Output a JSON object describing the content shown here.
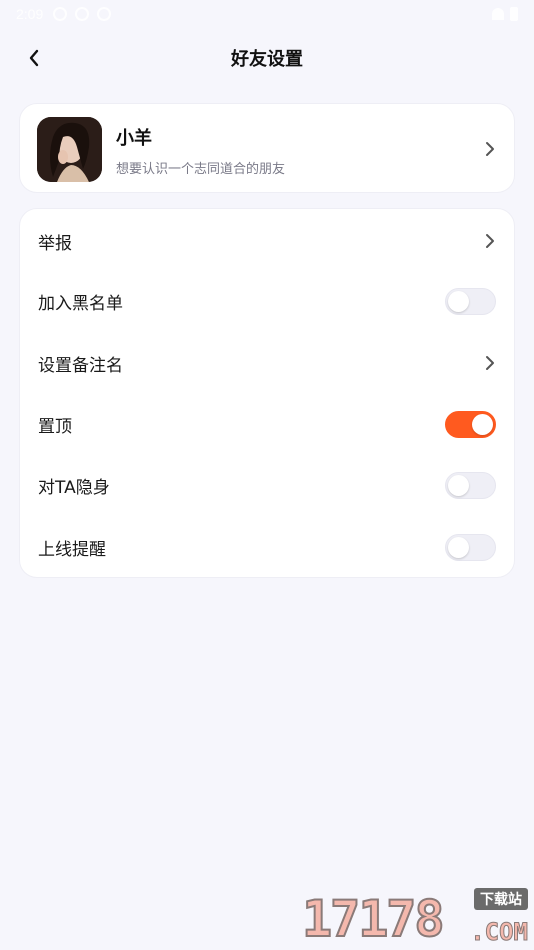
{
  "status_bar": {
    "time": "2:09"
  },
  "header": {
    "title": "好友设置"
  },
  "profile": {
    "name": "小羊",
    "bio": "想要认识一个志同道合的朋友"
  },
  "settings": [
    {
      "label": "举报",
      "kind": "link"
    },
    {
      "label": "加入黑名单",
      "kind": "toggle",
      "on": false
    },
    {
      "label": "设置备注名",
      "kind": "link"
    },
    {
      "label": "置顶",
      "kind": "toggle",
      "on": true
    },
    {
      "label": "对TA隐身",
      "kind": "toggle",
      "on": false
    },
    {
      "label": "上线提醒",
      "kind": "toggle",
      "on": false
    }
  ],
  "watermark": {
    "digits": "17178",
    "tag": "下载站",
    "suffix": ".COM"
  },
  "colors": {
    "accent": "#ff5a1f",
    "background": "#f6f6fc",
    "card": "#ffffff"
  }
}
